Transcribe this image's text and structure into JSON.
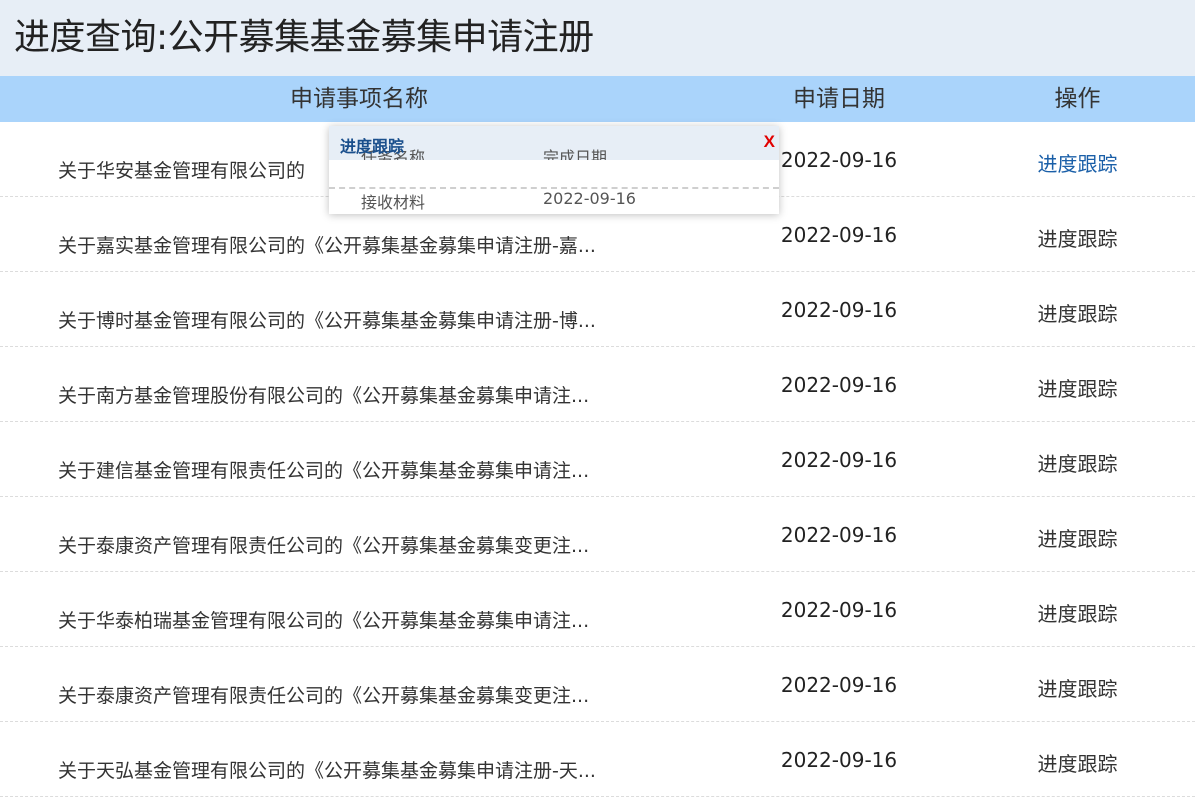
{
  "page": {
    "title": "进度查询:公开募集基金募集申请注册"
  },
  "table": {
    "headers": {
      "name": "申请事项名称",
      "date": "申请日期",
      "op": "操作"
    },
    "rows": [
      {
        "name": "关于华安基金管理有限公司的",
        "date": "2022-09-16",
        "op": "进度跟踪"
      },
      {
        "name": "关于嘉实基金管理有限公司的《公开募集基金募集申请注册-嘉...",
        "date": "2022-09-16",
        "op": "进度跟踪"
      },
      {
        "name": "关于博时基金管理有限公司的《公开募集基金募集申请注册-博...",
        "date": "2022-09-16",
        "op": "进度跟踪"
      },
      {
        "name": "关于南方基金管理股份有限公司的《公开募集基金募集申请注...",
        "date": "2022-09-16",
        "op": "进度跟踪"
      },
      {
        "name": "关于建信基金管理有限责任公司的《公开募集基金募集申请注...",
        "date": "2022-09-16",
        "op": "进度跟踪"
      },
      {
        "name": "关于泰康资产管理有限责任公司的《公开募集基金募集变更注...",
        "date": "2022-09-16",
        "op": "进度跟踪"
      },
      {
        "name": "关于华泰柏瑞基金管理有限公司的《公开募集基金募集申请注...",
        "date": "2022-09-16",
        "op": "进度跟踪"
      },
      {
        "name": "关于泰康资产管理有限责任公司的《公开募集基金募集变更注...",
        "date": "2022-09-16",
        "op": "进度跟踪"
      },
      {
        "name": "关于天弘基金管理有限公司的《公开募集基金募集申请注册-天...",
        "date": "2022-09-16",
        "op": "进度跟踪"
      }
    ]
  },
  "popup": {
    "title": "进度跟踪",
    "close_label": "X",
    "col1_header": "任务名称",
    "col2_header": "完成日期",
    "row1_task": "接收材料",
    "row1_date": "2022-09-16"
  },
  "colors": {
    "title_bg": "#e7eef6",
    "header_bg": "#aad4fb",
    "link_active": "#1a5fa8",
    "close_red": "#e10000"
  }
}
